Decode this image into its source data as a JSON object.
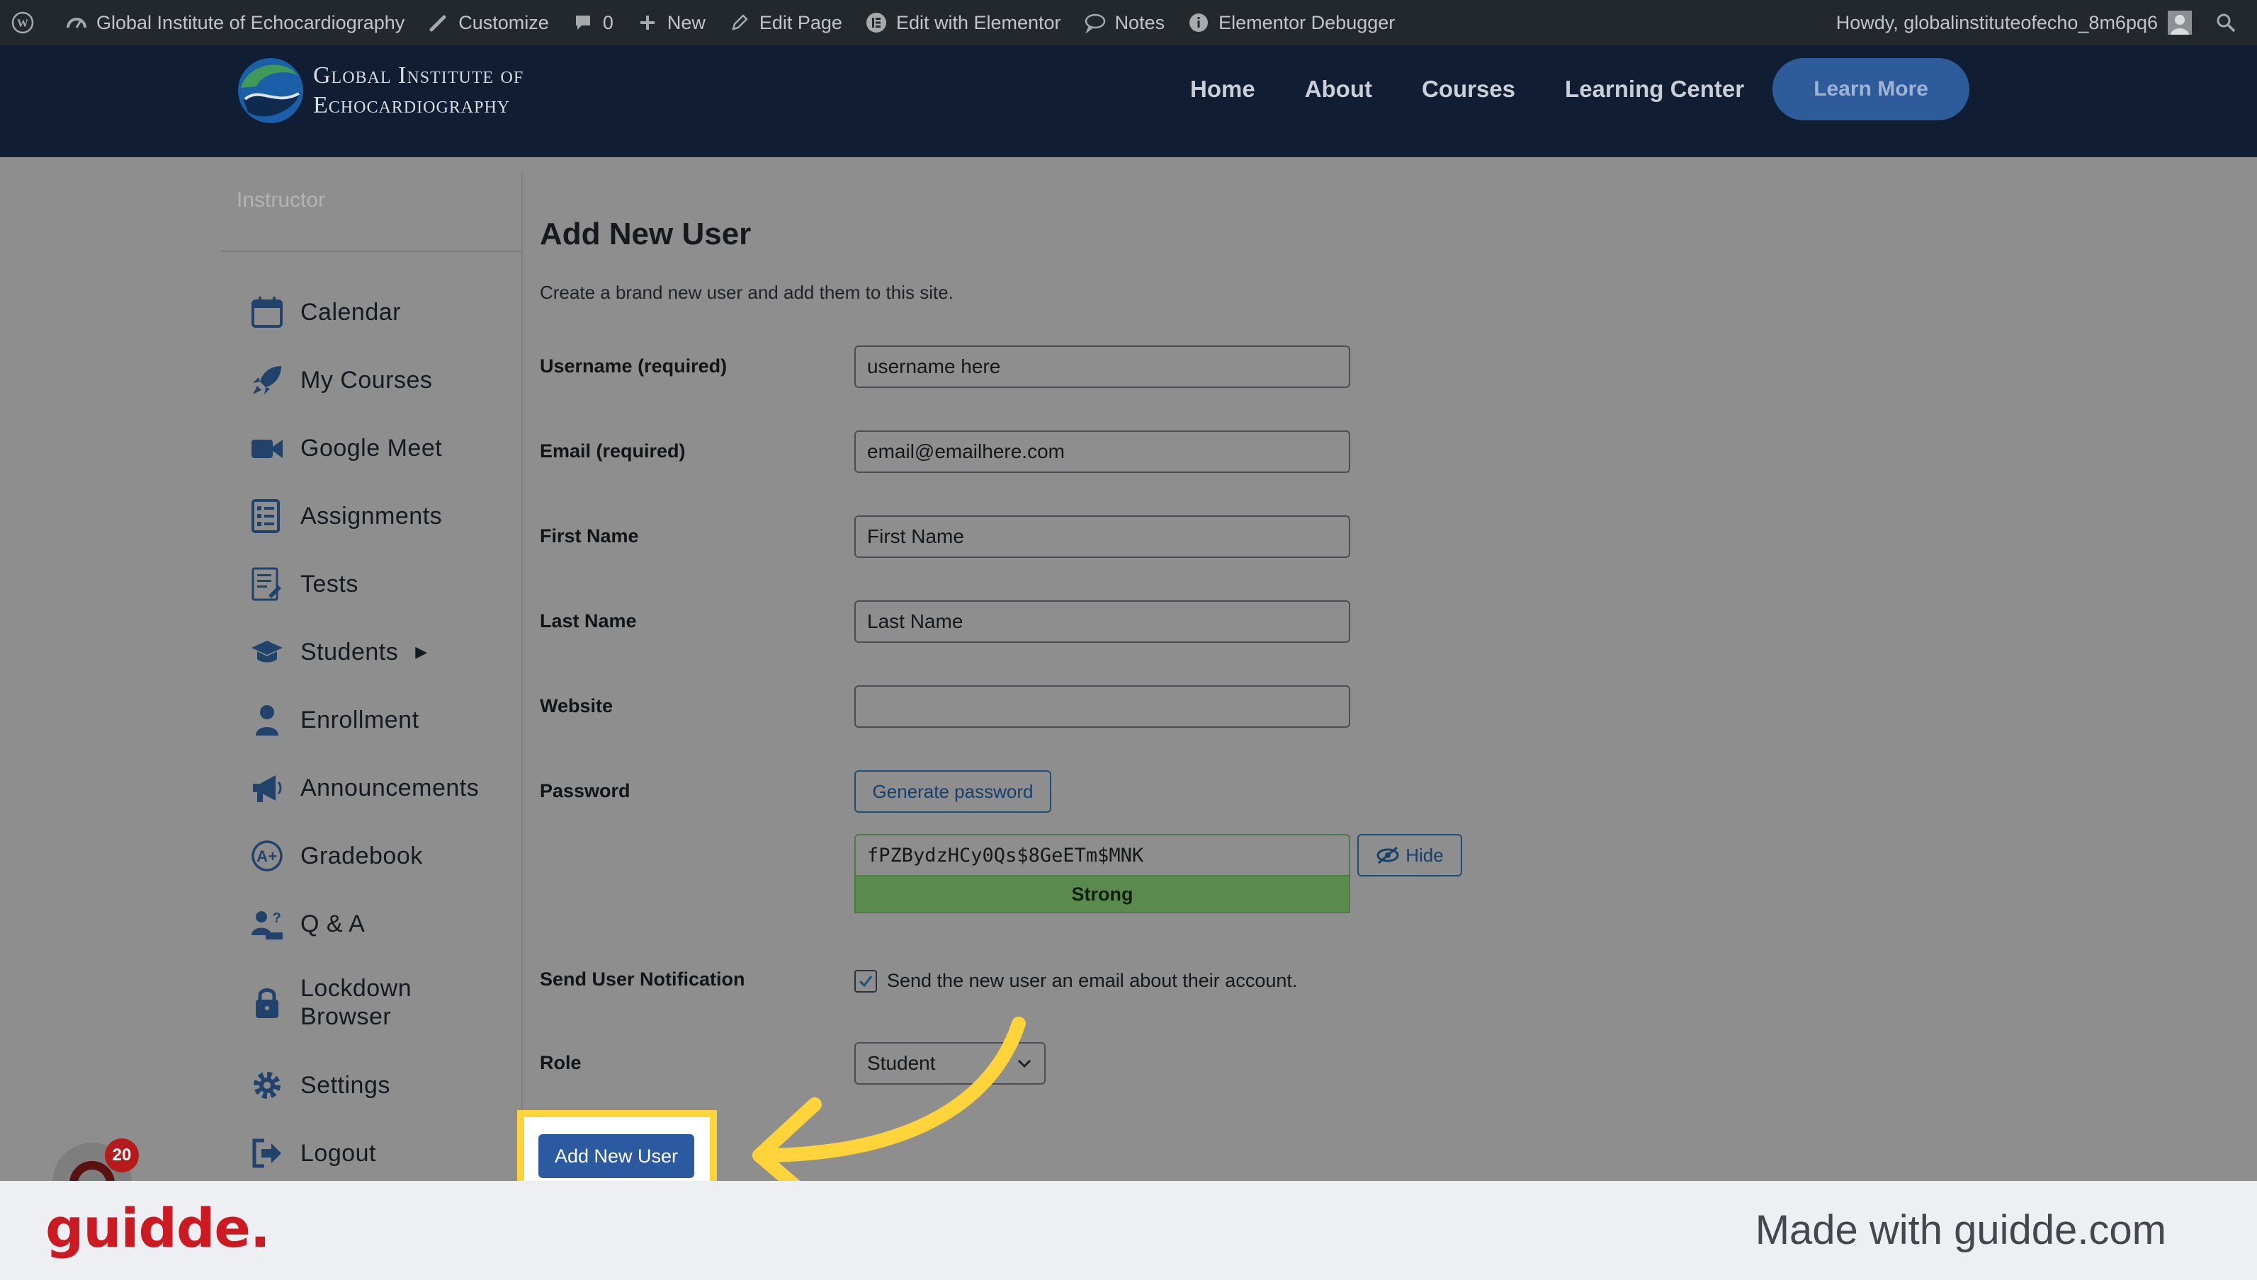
{
  "admin_bar": {
    "site_name": "Global Institute of Echocardiography",
    "customize": "Customize",
    "comments_count": "0",
    "new": "New",
    "edit_page": "Edit Page",
    "edit_elementor": "Edit with Elementor",
    "notes": "Notes",
    "debugger": "Elementor Debugger",
    "howdy": "Howdy, globalinstituteofecho_8m6pq6"
  },
  "header": {
    "logo_line1": "Global Institute of",
    "logo_line2": "Echocardiography",
    "nav": [
      "Home",
      "About",
      "Courses",
      "Learning Center"
    ],
    "cta": "Learn More"
  },
  "sidebar": {
    "title": "Instructor",
    "items": [
      {
        "label": "Calendar",
        "icon": "calendar-icon"
      },
      {
        "label": "My Courses",
        "icon": "rocket-icon"
      },
      {
        "label": "Google Meet",
        "icon": "video-camera-icon"
      },
      {
        "label": "Assignments",
        "icon": "checklist-icon"
      },
      {
        "label": "Tests",
        "icon": "test-sheet-icon"
      },
      {
        "label": "Students",
        "icon": "graduation-cap-icon"
      },
      {
        "label": "Enrollment",
        "icon": "user-icon"
      },
      {
        "label": "Announcements",
        "icon": "megaphone-icon"
      },
      {
        "label": "Gradebook",
        "icon": "grade-icon"
      },
      {
        "label": "Q & A",
        "icon": "qa-icon"
      },
      {
        "label": "Lockdown",
        "icon": "lock-icon"
      },
      {
        "label": "Settings",
        "icon": "gear-icon"
      },
      {
        "label": "Logout",
        "icon": "logout-icon"
      }
    ],
    "lockdown_line2": "Browser"
  },
  "form": {
    "title": "Add New User",
    "description": "Create a brand new user and add them to this site.",
    "username_label": "Username (required)",
    "username_value": "username here",
    "email_label": "Email (required)",
    "email_value": "email@emailhere.com",
    "first_name_label": "First Name",
    "first_name_value": "First Name",
    "last_name_label": "Last Name",
    "last_name_value": "Last Name",
    "website_label": "Website",
    "website_value": "",
    "password_label": "Password",
    "generate_password": "Generate password",
    "password_value": "fPZBydzHCy0Qs$8GeETm$MNK",
    "password_strength": "Strong",
    "hide_label": "Hide",
    "notification_label": "Send User Notification",
    "notification_text": "Send the new user an email about their account.",
    "notification_checked": true,
    "role_label": "Role",
    "role_value": "Student",
    "submit_label": "Add New User"
  },
  "badge_count": "20",
  "footer": {
    "brand": "guidde.",
    "made_with": "Made with guidde.com"
  },
  "colors": {
    "admin_bar": "#23282d",
    "header": "#111d33",
    "primary_button": "#2c5aa0",
    "highlight": "#ffd43b",
    "strength_good": "#5b8a4e",
    "guidde_red": "#cc1a23"
  }
}
